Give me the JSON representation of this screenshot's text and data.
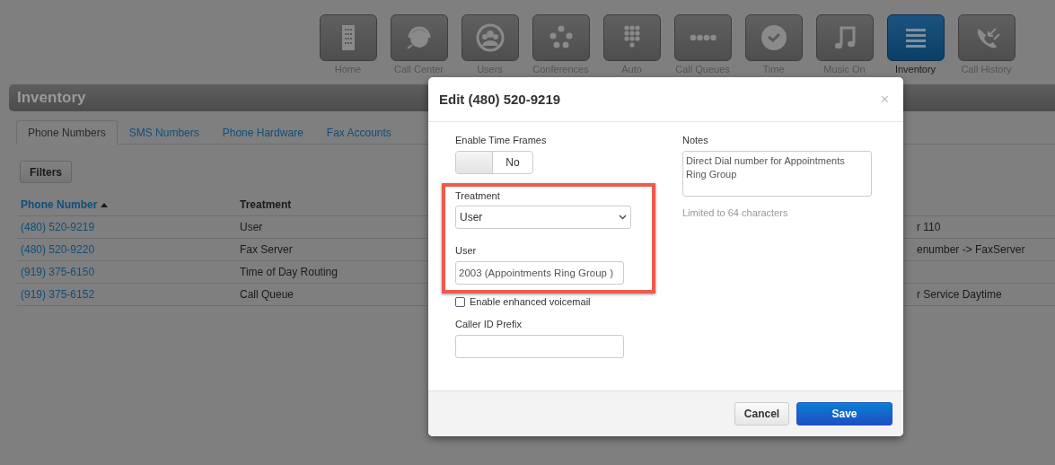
{
  "nav": [
    {
      "label": "Home",
      "selected": false
    },
    {
      "label": "Call Center",
      "selected": false
    },
    {
      "label": "Users",
      "selected": false
    },
    {
      "label": "Conferences",
      "selected": false
    },
    {
      "label": "Auto",
      "selected": false
    },
    {
      "label": "Call Queues",
      "selected": false
    },
    {
      "label": "Time",
      "selected": false
    },
    {
      "label": "Music On",
      "selected": false
    },
    {
      "label": "Inventory",
      "selected": true
    },
    {
      "label": "Call History",
      "selected": false
    }
  ],
  "page_title": "Inventory",
  "tabs": [
    {
      "label": "Phone Numbers",
      "selected": true
    },
    {
      "label": "SMS Numbers",
      "selected": false
    },
    {
      "label": "Phone Hardware",
      "selected": false
    },
    {
      "label": "Fax Accounts",
      "selected": false
    }
  ],
  "filters_button": "Filters",
  "table": {
    "columns": [
      {
        "label": "Phone Number",
        "sorted": true
      },
      {
        "label": "Treatment",
        "sorted": false
      }
    ],
    "rows": [
      {
        "phone": "(480) 520-9219",
        "treatment": "User",
        "column_3": "r 110"
      },
      {
        "phone": "(480) 520-9220",
        "treatment": "Fax Server",
        "column_3": "enumber -> FaxServer"
      },
      {
        "phone": "(919) 375-6150",
        "treatment": "Time of Day Routing"
      },
      {
        "phone": "(919) 375-6152",
        "treatment": "Call Queue",
        "column_3": "r Service Daytime"
      }
    ]
  },
  "dialog": {
    "title": "Edit (480) 520-9219",
    "close": "×",
    "time_frames": {
      "label": "Enable Time Frames",
      "on": false,
      "state_text": "No"
    },
    "treatment": {
      "label": "Treatment",
      "value": "User"
    },
    "user": {
      "label": "User",
      "value": "2003 (Appointments Ring Group )"
    },
    "voicemail": {
      "label": "Enable enhanced voicemail",
      "checked": false
    },
    "caller_id_prefix": {
      "label": "Caller ID Prefix"
    },
    "notes": {
      "label": "Notes",
      "value": "Direct Dial number for Appointments Ring Group",
      "hint": "Limited to 64 characters"
    },
    "buttons": [
      {
        "label": "Cancel",
        "kind": "secondary"
      },
      {
        "label": "Save",
        "kind": "primary"
      }
    ]
  }
}
